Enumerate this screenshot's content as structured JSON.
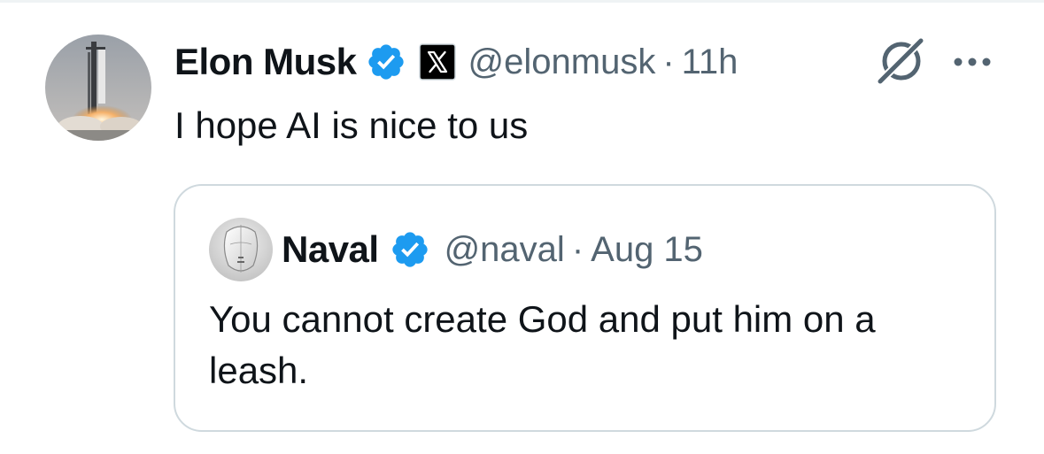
{
  "colors": {
    "text_primary": "#0f1419",
    "text_secondary": "#536471",
    "verified_blue": "#1d9bf0",
    "border": "#cfd9de"
  },
  "tweet": {
    "author_name": "Elon Musk",
    "verified_icon": "verified-badge-icon",
    "affiliate_icon": "x-logo-icon",
    "handle": "@elonmusk",
    "separator": "·",
    "time": "11h",
    "text": "I hope AI is nice to us",
    "actions": {
      "grok_icon": "grok-icon",
      "more_icon": "more-options-icon"
    }
  },
  "quoted_tweet": {
    "author_name": "Naval",
    "verified_icon": "verified-badge-icon",
    "handle": "@naval",
    "separator": "·",
    "time": "Aug 15",
    "text": "You cannot create God and put him on a leash."
  }
}
